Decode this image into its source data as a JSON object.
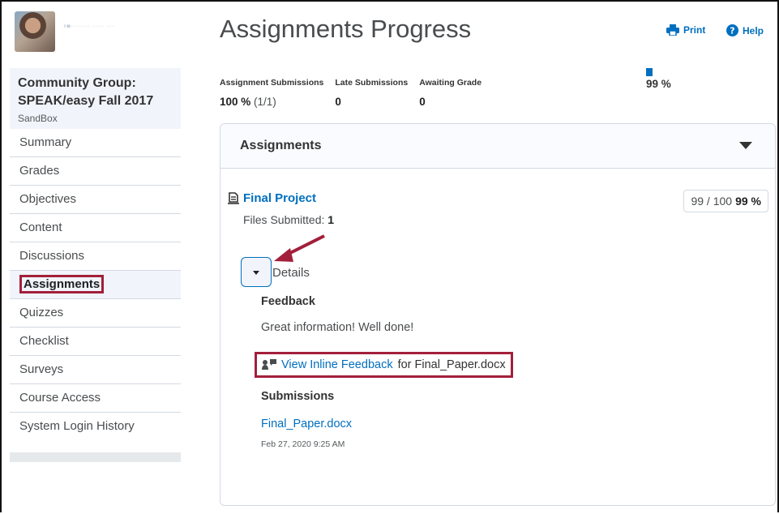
{
  "sidebar": {
    "user_blurred_text": "Тм········ ····· ···",
    "org_title": "Community Group: SPEAK/easy Fall 2017",
    "org_subtitle": "SandBox",
    "items": [
      {
        "label": "Summary"
      },
      {
        "label": "Grades"
      },
      {
        "label": "Objectives"
      },
      {
        "label": "Content"
      },
      {
        "label": "Discussions"
      },
      {
        "label": "Assignments",
        "active": true
      },
      {
        "label": "Quizzes"
      },
      {
        "label": "Checklist"
      },
      {
        "label": "Surveys"
      },
      {
        "label": "Course Access"
      },
      {
        "label": "System Login History"
      }
    ]
  },
  "header": {
    "title": "Assignments Progress",
    "print_label": "Print",
    "help_label": "Help"
  },
  "stats": {
    "submissions_label": "Assignment Submissions",
    "submissions_value": "100 %",
    "submissions_sub": "(1/1)",
    "late_label": "Late Submissions",
    "late_value": "0",
    "awaiting_label": "Awaiting Grade",
    "awaiting_value": "0",
    "overall_percent": "99 %"
  },
  "panel": {
    "title": "Assignments",
    "item_title": "Final Project",
    "files_label": "Files Submitted:",
    "files_count": "1",
    "score": "99 / 100",
    "score_percent": "99 %",
    "details_label": "Details",
    "feedback_heading": "Feedback",
    "feedback_text": "Great information! Well done!",
    "inline_link": "View Inline Feedback",
    "inline_for": "for Final_Paper.docx",
    "submissions_heading": "Submissions",
    "submission_file": "Final_Paper.docx",
    "submission_date": "Feb 27, 2020 9:25 AM"
  },
  "colors": {
    "link": "#006fbf",
    "highlight_border": "#a31f3b",
    "sidebar_bg": "#f1f5fb"
  }
}
